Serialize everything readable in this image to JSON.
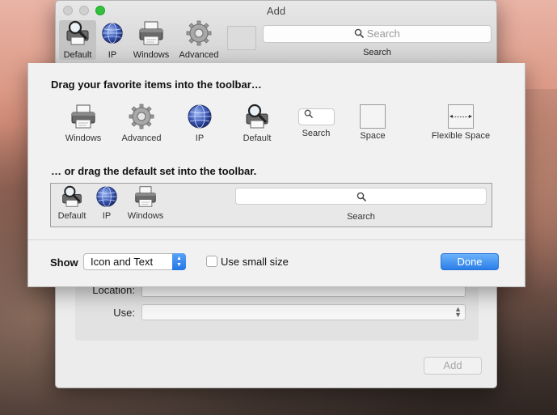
{
  "window": {
    "title": "Add",
    "toolbar": {
      "items": [
        {
          "label": "Default",
          "icon": "default-printer-icon"
        },
        {
          "label": "IP",
          "icon": "ip-globe-icon"
        },
        {
          "label": "Windows",
          "icon": "windows-printer-icon"
        },
        {
          "label": "Advanced",
          "icon": "advanced-gear-icon"
        }
      ],
      "search_placeholder": "Search",
      "search_label": "Search"
    },
    "form": {
      "location_label": "Location:",
      "use_label": "Use:"
    },
    "add_button": "Add"
  },
  "customize": {
    "palette_heading": "Drag your favorite items into the toolbar…",
    "palette_items": [
      {
        "label": "Windows",
        "icon": "windows-printer-icon"
      },
      {
        "label": "Advanced",
        "icon": "advanced-gear-icon"
      },
      {
        "label": "IP",
        "icon": "ip-globe-icon"
      },
      {
        "label": "Default",
        "icon": "default-printer-icon"
      },
      {
        "label": "Search",
        "icon": "search-icon"
      },
      {
        "label": "Space",
        "icon": "space-icon"
      },
      {
        "label": "Flexible Space",
        "icon": "flexible-space-icon"
      }
    ],
    "default_heading": "… or drag the default set into the toolbar.",
    "default_set": [
      {
        "label": "Default",
        "icon": "default-printer-icon"
      },
      {
        "label": "IP",
        "icon": "ip-globe-icon"
      },
      {
        "label": "Windows",
        "icon": "windows-printer-icon"
      },
      {
        "label": "Search",
        "icon": "search-icon"
      }
    ],
    "show_label": "Show",
    "show_value": "Icon and Text",
    "small_size_label": "Use small size",
    "small_size_checked": false,
    "done_button": "Done"
  },
  "colors": {
    "accent": "#2b7ee9",
    "zoom_button": "#31c13b"
  }
}
